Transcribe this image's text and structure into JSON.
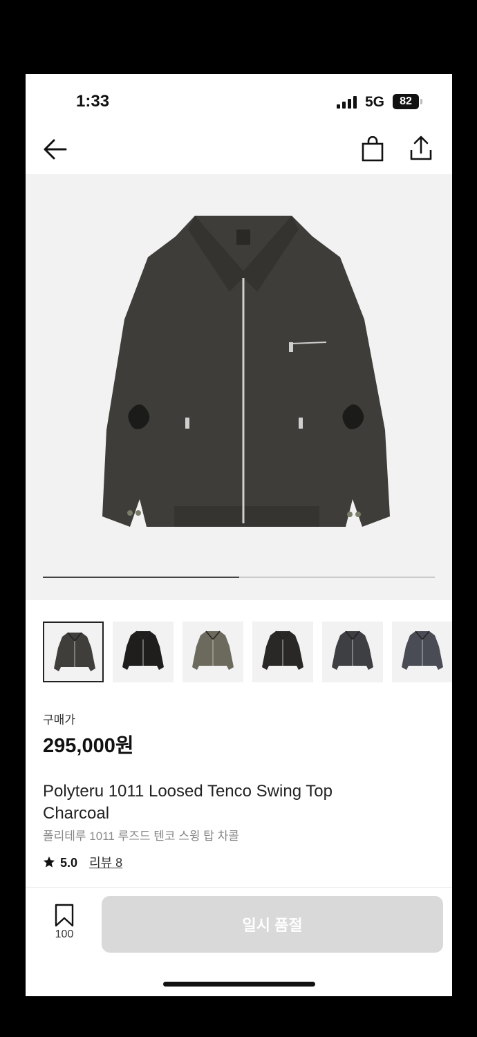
{
  "status_bar": {
    "time": "1:33",
    "network": "5G",
    "battery": "82"
  },
  "nav": {
    "back_icon": "back-arrow-icon",
    "bag_icon": "shopping-bag-icon",
    "share_icon": "share-icon"
  },
  "gallery": {
    "progress": 0.5,
    "thumbnails": [
      {
        "color": "#3f3e3b",
        "selected": true
      },
      {
        "color": "#1f1e1d",
        "selected": false
      },
      {
        "color": "#6b6a5c",
        "selected": false
      },
      {
        "color": "#2a2826",
        "selected": false
      },
      {
        "color": "#3e3f42",
        "selected": false
      },
      {
        "color": "#4a4c55",
        "selected": false
      }
    ]
  },
  "product": {
    "price_label": "구매가",
    "price": "295,000원",
    "title": "Polyteru 1011 Loosed Tenco Swing Top Charcoal",
    "subtitle": "폴리테루 1011 루즈드 텐코 스윙 탑 차콜",
    "rating": "5.0",
    "review_link": "리뷰 8"
  },
  "bottom_bar": {
    "wishlist_count": "100",
    "soldout_label": "일시 품절"
  },
  "colors": {
    "jacket": "#3e3d3a",
    "button_disabled": "#d9d9d9"
  }
}
